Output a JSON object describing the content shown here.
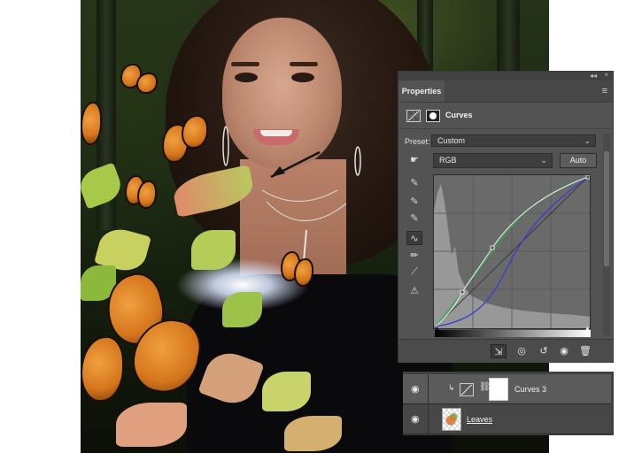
{
  "canvas": {
    "background_colors": {
      "forest": "#1c2814",
      "skin": "#b9846c",
      "hair": "#23160f",
      "dress": "#0a0a0c",
      "butterfly": "#d5761c",
      "leaf": "#9cc24a"
    }
  },
  "properties_panel": {
    "tab_label": "Properties",
    "adjustment_type": "Curves",
    "preset": {
      "label": "Preset:",
      "value": "Custom"
    },
    "channel": {
      "value": "RGB"
    },
    "auto_label": "Auto",
    "tools": [
      "on-image-adjust-icon",
      "black-point-eyedropper-icon",
      "gray-point-eyedropper-icon",
      "white-point-eyedropper-icon",
      "curve-points-icon",
      "pencil-icon",
      "smooth-curve-icon",
      "clipping-warning-icon"
    ],
    "bottom_buttons": [
      "clip-to-layer-icon",
      "view-previous-icon",
      "reset-icon",
      "visibility-icon",
      "trash-icon"
    ],
    "curve_colors": {
      "rgb": "#e8e8e8",
      "green": "#2fa84a",
      "blue": "#3a3ad8"
    }
  },
  "layers": [
    {
      "name": "Curves 3",
      "selected": true,
      "type": "adjustment",
      "clipped": true
    },
    {
      "name": "Leaves",
      "selected": false,
      "type": "pixel"
    }
  ]
}
